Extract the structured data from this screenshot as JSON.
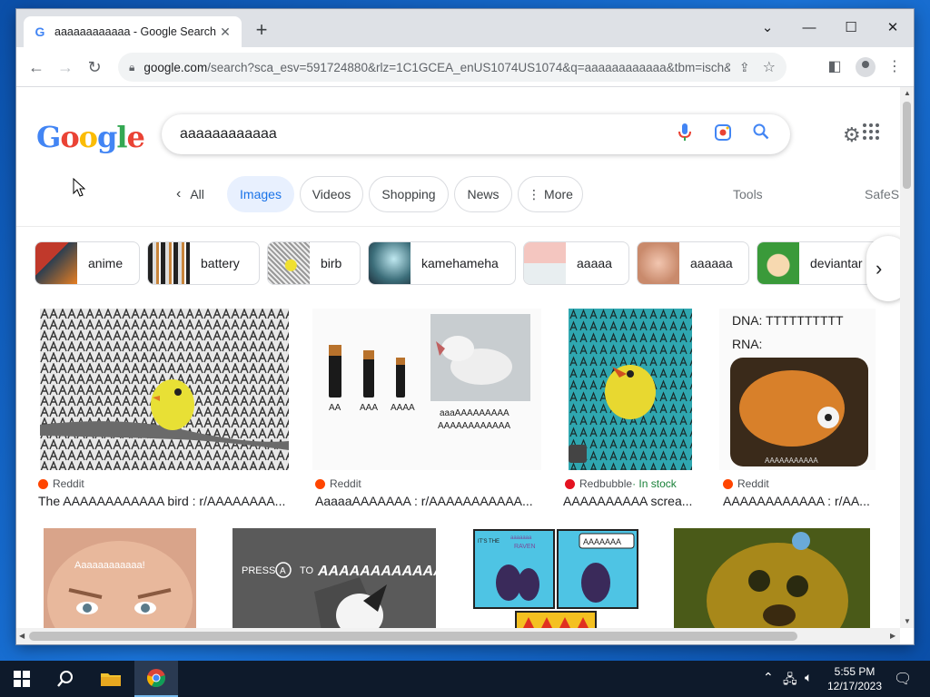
{
  "browser": {
    "tab_title": "aaaaaaaaaaaa - Google Search",
    "favicon": "G",
    "url_host": "google.com",
    "url_rest": "/search?sca_esv=591724880&rlz=1C1GCEA_enUS1074US1074&q=aaaaaaaaaaaa&tbm=isch&s..."
  },
  "search": {
    "logo": [
      "G",
      "o",
      "o",
      "g",
      "l",
      "e"
    ],
    "query": "aaaaaaaaaaaa"
  },
  "nav_tabs": {
    "all": "All",
    "images": "Images",
    "videos": "Videos",
    "shopping": "Shopping",
    "news": "News",
    "more": "More",
    "tools": "Tools",
    "safesearch": "SafeS"
  },
  "refinements": [
    {
      "label": "anime"
    },
    {
      "label": "battery"
    },
    {
      "label": "birb"
    },
    {
      "label": "kamehameha"
    },
    {
      "label": "aaaaa"
    },
    {
      "label": "aaaaaa"
    },
    {
      "label": "deviantar"
    }
  ],
  "results": [
    {
      "source": "Reddit",
      "title": "The AAAAAAAAAAAA bird : r/AAAAAAAA..."
    },
    {
      "source": "Reddit",
      "title": "AaaaaAAAAAAA : r/AAAAAAAAAAA..."
    },
    {
      "source": "Redbubble",
      "stock": " · In stock",
      "title": "AAAAAAAAAA screa..."
    },
    {
      "source": "Reddit",
      "title": "AAAAAAAAAAAA : r/AA..."
    }
  ],
  "image_text": {
    "dna": "DNA: TTTTTTTTTT",
    "rna": "RNA:",
    "opossum": "aaaAAAAAAAAA",
    "opossum2": "AAAAAAAAAAAA",
    "aa": "AA",
    "aaa": "AAA",
    "aaaa": "AAAA",
    "baby": "Aaaaaaaaaaaa!",
    "press": "PRESS",
    "press_btn": "A",
    "press_to": "TO",
    "press_scream": "AAAAAAAAAAAAA",
    "raven_title": "IT'S THE",
    "raven": "RAVEN",
    "raven_speech": "AAAAAAA",
    "raven_small": "aaaaaaa",
    "jake_caption": "AAAAAAAAAAA"
  },
  "taskbar": {
    "time": "5:55 PM",
    "date": "12/17/2023"
  }
}
